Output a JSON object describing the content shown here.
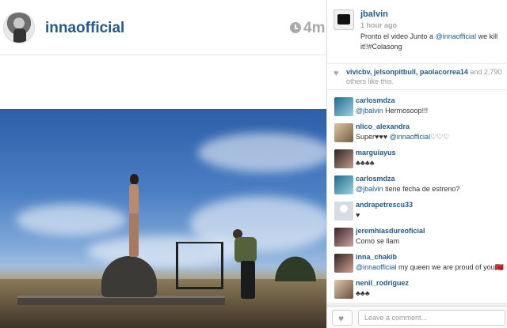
{
  "post": {
    "username": "innaofficial",
    "time": "4m",
    "photo_alt": "Photo: woman standing on a hay bale, film crew and camera in a field under a blue sky"
  },
  "caption": {
    "username": "jbalvin",
    "time": "1 hour ago",
    "text_before": "Pronto el video Junto a ",
    "mention": "@innaofficial",
    "text_after": " we kill it!!#Colasong"
  },
  "likes": {
    "names": "vivicbv, jelsonpitbull, paolacorrea14",
    "rest": " and 2,790 others like this."
  },
  "comments": [
    {
      "user": "carlosmdza",
      "mention": "@jbalvin",
      "text": " Hermosoop!!!",
      "avatar": "av1"
    },
    {
      "user": "nlico_alexandra",
      "text": "Super♥♥♥ ",
      "mention2": "@innaofficial",
      "text2": "♡♡♡",
      "avatar": "av2"
    },
    {
      "user": "marguiayus",
      "text": "♣♣♣♣",
      "avatar": "av3"
    },
    {
      "user": "carlosmdza",
      "mention": "@jbalvin",
      "text": " tiene fecha de estreno?",
      "avatar": "av4"
    },
    {
      "user": "andrapetrescu33",
      "text": "♥",
      "avatar": "av5"
    },
    {
      "user": "jeremhiasdureoficial",
      "text": "Como se llam",
      "avatar": "av6"
    },
    {
      "user": "inna_chakib",
      "mention": "@innaofficial",
      "text": " my queen we are proud of you🇲🇦",
      "avatar": "av7"
    },
    {
      "user": "nenil_rodriguez",
      "text": "♣♣♣",
      "avatar": "av8"
    }
  ],
  "comment_box": {
    "placeholder": "Leave a comment..."
  },
  "icons": {
    "clock": "clock-icon",
    "heart": "heart-icon"
  }
}
